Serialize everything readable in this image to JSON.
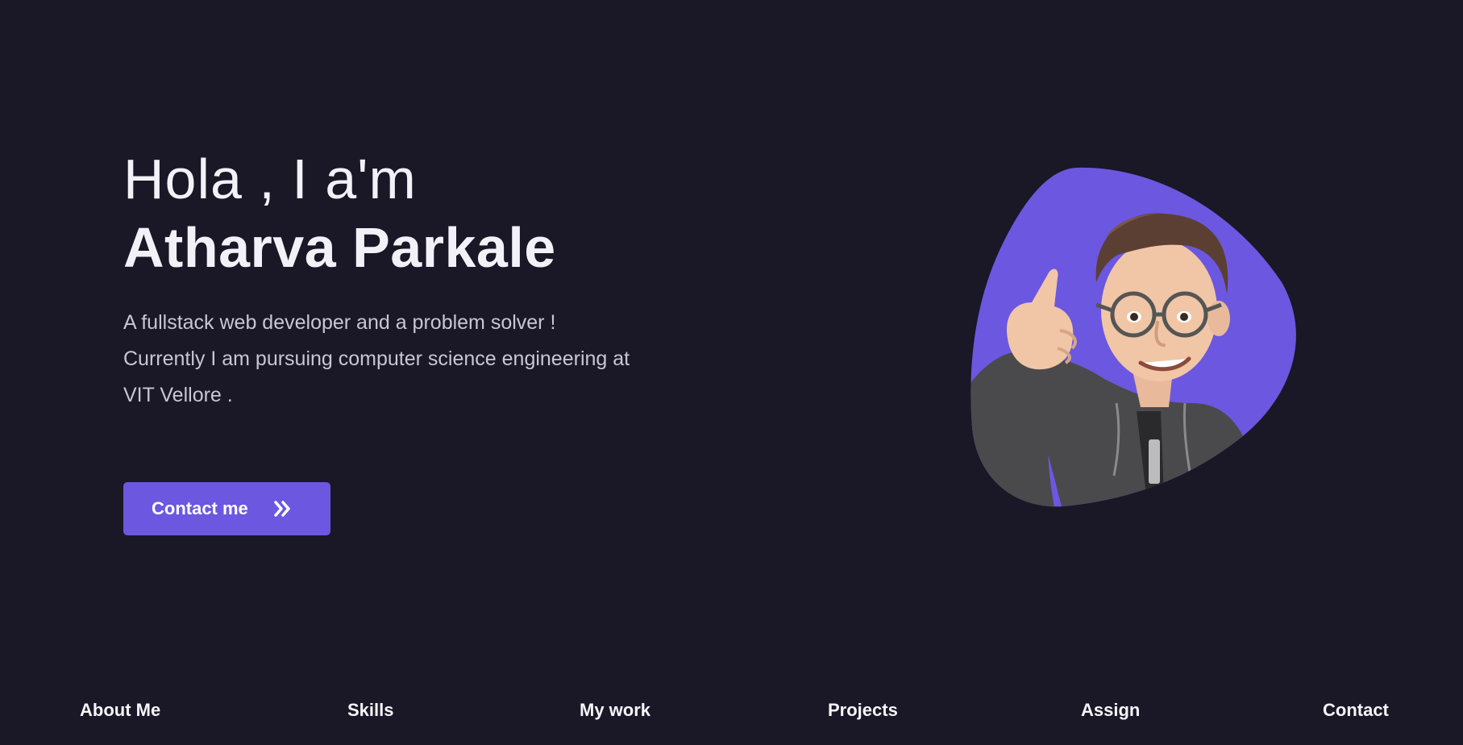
{
  "hero": {
    "greeting": "Hola , I a'm",
    "name": "Atharva Parkale",
    "description_lines": [
      "A fullstack web developer and a problem solver !",
      "Currently I am pursuing computer science engineering at",
      "VIT Vellore ."
    ],
    "contact_button": {
      "label": "Contact me",
      "icon": "double-chevron-right-icon"
    }
  },
  "avatar": {
    "icon": "memoji-avatar",
    "blob_color": "#6c57e0"
  },
  "nav": {
    "items": [
      {
        "label": "About Me"
      },
      {
        "label": "Skills"
      },
      {
        "label": "My work"
      },
      {
        "label": "Projects"
      },
      {
        "label": "Assign"
      },
      {
        "label": "Contact"
      }
    ]
  },
  "colors": {
    "background": "#1a1726",
    "accent": "#6c57e0",
    "text_primary": "#f3f1f8",
    "text_secondary": "#c9c6d4"
  }
}
